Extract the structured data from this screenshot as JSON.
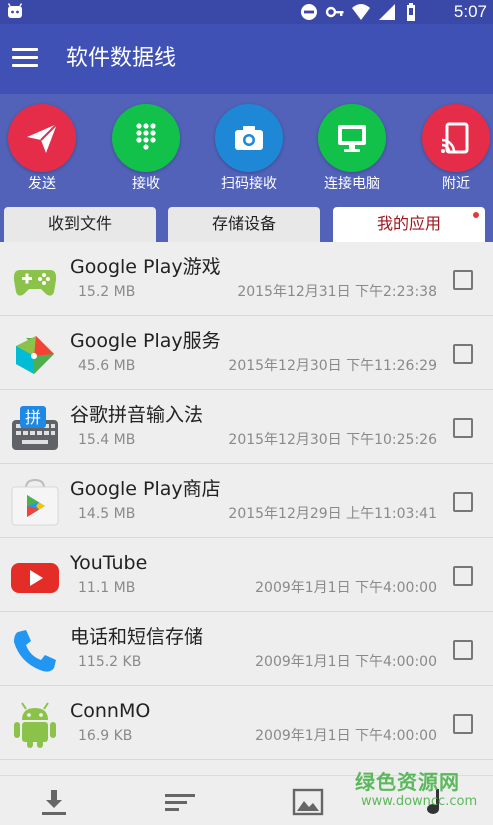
{
  "status_bar": {
    "time": "5:07",
    "icons": [
      "android-icon",
      "do-not-disturb-icon",
      "key-icon",
      "wifi-icon",
      "signal-icon",
      "battery-icon"
    ]
  },
  "app_bar": {
    "title": "软件数据线",
    "menu_icon": "menu-icon"
  },
  "actions": [
    {
      "label": "发送",
      "icon": "send-icon",
      "color": "#e52d4a"
    },
    {
      "label": "接收",
      "icon": "dialpad-icon",
      "color": "#12c14a"
    },
    {
      "label": "扫码接收",
      "icon": "camera-icon",
      "color": "#1e88d6"
    },
    {
      "label": "连接电脑",
      "icon": "monitor-icon",
      "color": "#12c14a"
    },
    {
      "label": "附近",
      "icon": "cast-icon",
      "color": "#e52d4a"
    }
  ],
  "tabs": [
    {
      "label": "收到文件",
      "active": false
    },
    {
      "label": "存储设备",
      "active": false
    },
    {
      "label": "我的应用",
      "active": true
    }
  ],
  "apps": [
    {
      "name": "Google Play游戏",
      "size": "15.2 MB",
      "date": "2015年12月31日 下午2:23:38",
      "icon": "play-games-icon",
      "checked": false
    },
    {
      "name": "Google Play服务",
      "size": "45.6 MB",
      "date": "2015年12月30日 下午11:26:29",
      "icon": "play-services-icon",
      "checked": false
    },
    {
      "name": "谷歌拼音输入法",
      "size": "15.4 MB",
      "date": "2015年12月30日 下午10:25:26",
      "icon": "pinyin-keyboard-icon",
      "icon_text": "拼",
      "checked": false
    },
    {
      "name": "Google Play商店",
      "size": "14.5 MB",
      "date": "2015年12月29日 上午11:03:41",
      "icon": "play-store-icon",
      "checked": false
    },
    {
      "name": "YouTube",
      "size": "11.1 MB",
      "date": "2009年1月1日 下午4:00:00",
      "icon": "youtube-icon",
      "checked": false
    },
    {
      "name": "电话和短信存储",
      "size": "115.2 KB",
      "date": "2009年1月1日 下午4:00:00",
      "icon": "phone-icon",
      "checked": false
    },
    {
      "name": "ConnMO",
      "size": "16.9 KB",
      "date": "2009年1月1日 下午4:00:00",
      "icon": "android-robot-icon",
      "checked": false
    }
  ],
  "bottom_bar": [
    {
      "icon": "download-icon"
    },
    {
      "icon": "sort-icon"
    },
    {
      "icon": "image-icon"
    },
    {
      "icon": "music-icon"
    }
  ],
  "watermark": {
    "text": "绿色资源网",
    "url": "www.downcc.com"
  }
}
